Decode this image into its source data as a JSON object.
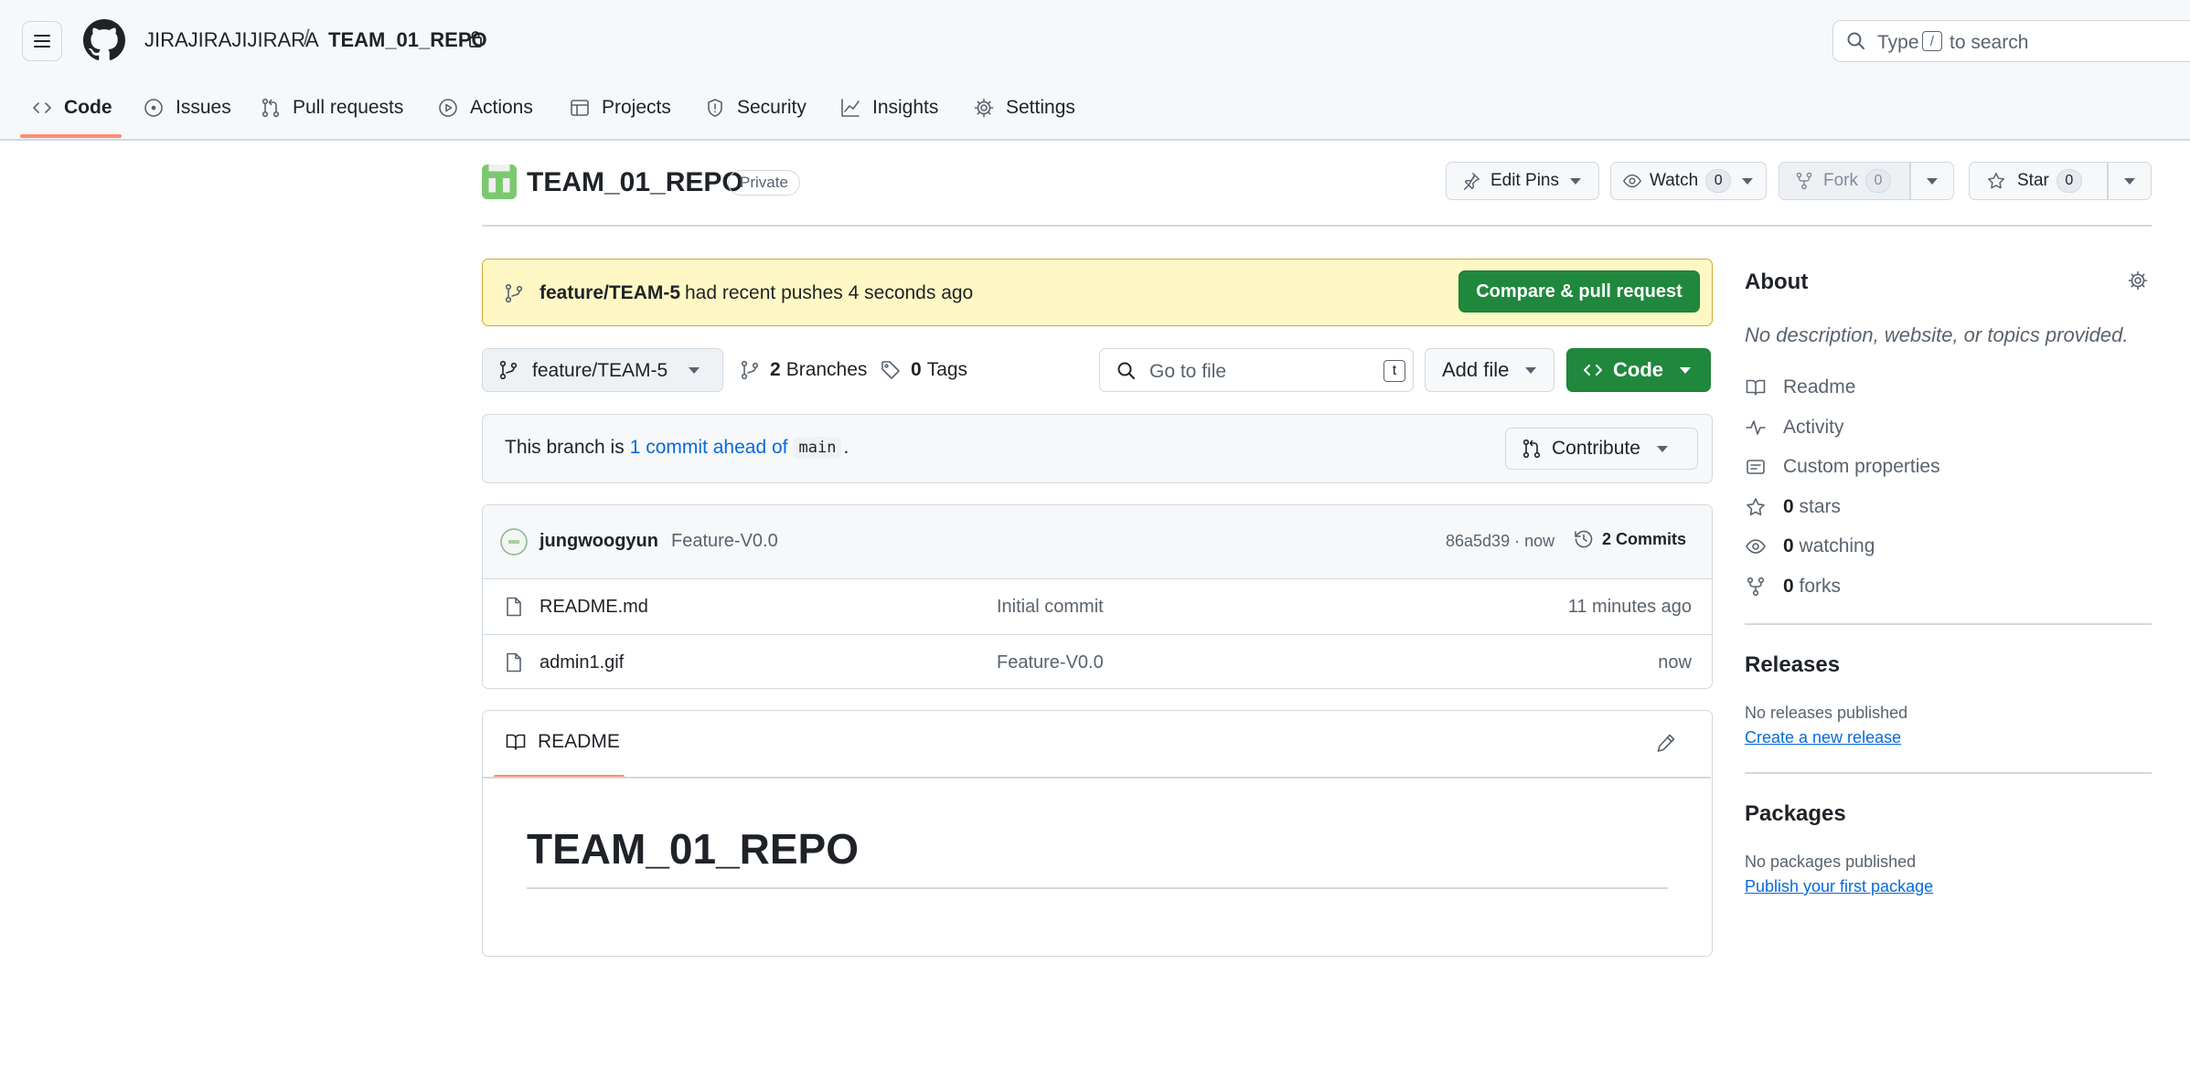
{
  "header": {
    "owner": "JIRAJIRAJIJIRARA",
    "separator": "/",
    "repo": "TEAM_01_REPO",
    "search": {
      "prefix": "Type",
      "key": "/",
      "suffix": "to search"
    }
  },
  "nav_tabs": [
    {
      "label": "Code",
      "icon": "code-icon",
      "active": true
    },
    {
      "label": "Issues",
      "icon": "issue-opened-icon"
    },
    {
      "label": "Pull requests",
      "icon": "pull-request-icon"
    },
    {
      "label": "Actions",
      "icon": "play-icon"
    },
    {
      "label": "Projects",
      "icon": "table-icon"
    },
    {
      "label": "Security",
      "icon": "shield-icon"
    },
    {
      "label": "Insights",
      "icon": "graph-icon"
    },
    {
      "label": "Settings",
      "icon": "gear-icon"
    }
  ],
  "repo": {
    "title": "TEAM_01_REPO",
    "visibility": "Private",
    "edit_pins": "Edit Pins",
    "watch": {
      "label": "Watch",
      "count": "0"
    },
    "fork": {
      "label": "Fork",
      "count": "0"
    },
    "star": {
      "label": "Star",
      "count": "0"
    }
  },
  "banner": {
    "branch": "feature/TEAM-5",
    "text": "had recent pushes 4 seconds ago",
    "button": "Compare & pull request"
  },
  "branch_bar": {
    "current_branch": "feature/TEAM-5",
    "branches_count": "2",
    "branches_label": "Branches",
    "tags_count": "0",
    "tags_label": "Tags",
    "goto_placeholder": "Go to file",
    "goto_key": "t",
    "add_file": "Add file",
    "code": "Code"
  },
  "ahead": {
    "prefix": "This branch is",
    "link": "1 commit ahead of",
    "base": "main",
    "suffix": ".",
    "contribute": "Contribute"
  },
  "latest_commit": {
    "author": "jungwoogyun",
    "message": "Feature-V0.0",
    "sha_time": "86a5d39 · now",
    "commits_label": "2 Commits"
  },
  "files": [
    {
      "name": "README.md",
      "commit": "Initial commit",
      "time": "11 minutes ago"
    },
    {
      "name": "admin1.gif",
      "commit": "Feature-V0.0",
      "time": "now"
    }
  ],
  "readme": {
    "tab": "README",
    "heading": "TEAM_01_REPO"
  },
  "sidebar": {
    "about_title": "About",
    "description": "No description, website, or topics provided.",
    "items": [
      {
        "label": "Readme",
        "icon": "book-icon"
      },
      {
        "label": "Activity",
        "icon": "pulse-icon"
      },
      {
        "label": "Custom properties",
        "icon": "note-icon"
      },
      {
        "count": "0",
        "label": "stars",
        "icon": "star-icon"
      },
      {
        "count": "0",
        "label": "watching",
        "icon": "eye-icon"
      },
      {
        "count": "0",
        "label": "forks",
        "icon": "repo-forked-icon"
      }
    ],
    "releases_title": "Releases",
    "releases_text": "No releases published",
    "releases_link": "Create a new release",
    "packages_title": "Packages",
    "packages_text": "No packages published",
    "packages_link": "Publish your first package"
  }
}
